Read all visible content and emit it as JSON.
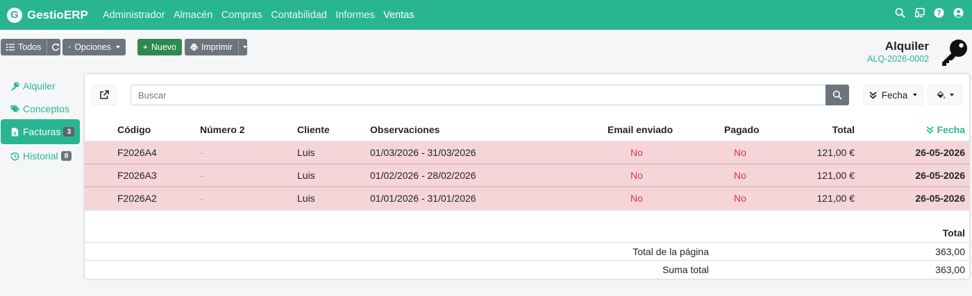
{
  "app": {
    "brand_letter": "G",
    "brand": "GestioERP",
    "accent": "#29b592",
    "menu": [
      "Administrador",
      "Almacén",
      "Compras",
      "Contabilidad",
      "Informes",
      "Ventas"
    ],
    "icons": [
      "search-icon",
      "display-icon",
      "help-icon",
      "user-icon"
    ]
  },
  "toolbar": {
    "all_label": "Todos",
    "options_label": "Opciones",
    "new_label": "Nuevo",
    "print_label": "Imprimir"
  },
  "record": {
    "title": "Alquiler",
    "code": "ALQ-2026-0002"
  },
  "sidebar": {
    "items": [
      {
        "label": "Alquiler",
        "icon": "key-icon"
      },
      {
        "label": "Conceptos",
        "icon": "tags-icon"
      },
      {
        "label": "Facturas",
        "icon": "file-icon",
        "badge": "3"
      },
      {
        "label": "Historial",
        "icon": "history-icon",
        "badge": "8"
      }
    ]
  },
  "list": {
    "search_placeholder": "Buscar",
    "sort_label": "Fecha",
    "columns": [
      "Código",
      "Número 2",
      "Cliente",
      "Observaciones",
      "Email enviado",
      "Pagado",
      "Total",
      "Fecha"
    ],
    "rows": [
      {
        "codigo": "F2026A4",
        "numero2": "-",
        "cliente": "Luis",
        "observaciones": "01/03/2026 - 31/03/2026",
        "email": "No",
        "pagado": "No",
        "total": "121,00 €",
        "fecha": "26-05-2026"
      },
      {
        "codigo": "F2026A3",
        "numero2": "-",
        "cliente": "Luis",
        "observaciones": "01/02/2026 - 28/02/2026",
        "email": "No",
        "pagado": "No",
        "total": "121,00 €",
        "fecha": "26-05-2026"
      },
      {
        "codigo": "F2026A2",
        "numero2": "-",
        "cliente": "Luis",
        "observaciones": "01/01/2026 - 31/01/2026",
        "email": "No",
        "pagado": "No",
        "total": "121,00 €",
        "fecha": "26-05-2026"
      }
    ],
    "row_color": "#f5d5d8"
  },
  "totals": {
    "header": "Total",
    "page_label": "Total de la página",
    "page_value": "363,00",
    "sum_label": "Suma total",
    "sum_value": "363,00"
  }
}
